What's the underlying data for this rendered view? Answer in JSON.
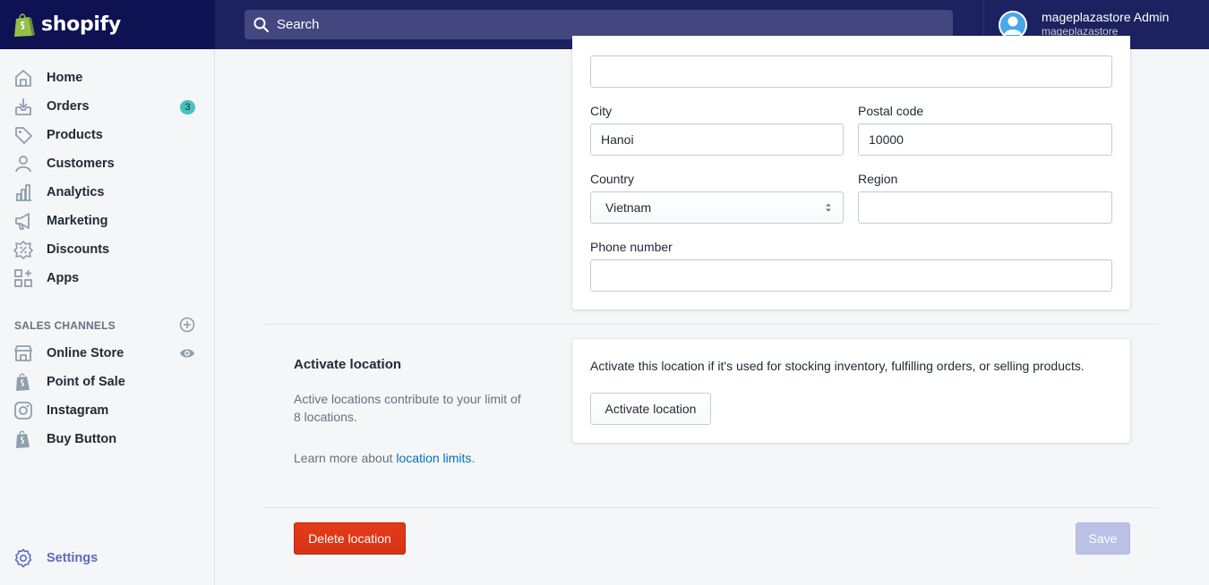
{
  "app": {
    "brand": "shopify"
  },
  "search": {
    "placeholder": "Search"
  },
  "user": {
    "name": "mageplazastore Admin",
    "store": "mageplazastore"
  },
  "sidebar": {
    "items": [
      {
        "label": "Home",
        "icon": "home-icon"
      },
      {
        "label": "Orders",
        "icon": "orders-icon",
        "badge": "3"
      },
      {
        "label": "Products",
        "icon": "tag-icon"
      },
      {
        "label": "Customers",
        "icon": "person-icon"
      },
      {
        "label": "Analytics",
        "icon": "bar-chart-icon"
      },
      {
        "label": "Marketing",
        "icon": "megaphone-icon"
      },
      {
        "label": "Discounts",
        "icon": "discount-icon"
      },
      {
        "label": "Apps",
        "icon": "apps-icon"
      }
    ],
    "sales_channels_title": "SALES CHANNELS",
    "channels": [
      {
        "label": "Online Store",
        "icon": "store-icon"
      },
      {
        "label": "Point of Sale",
        "icon": "shopify-bag-icon"
      },
      {
        "label": "Instagram",
        "icon": "instagram-icon"
      },
      {
        "label": "Buy Button",
        "icon": "shopify-bag-icon"
      }
    ],
    "settings": {
      "label": "Settings",
      "icon": "gear-icon"
    }
  },
  "address_form": {
    "city_label": "City",
    "city_value": "Hanoi",
    "postal_label": "Postal code",
    "postal_value": "10000",
    "country_label": "Country",
    "country_value": "Vietnam",
    "region_label": "Region",
    "region_value": "",
    "phone_label": "Phone number",
    "phone_value": ""
  },
  "activate_section": {
    "heading": "Activate location",
    "description": "Active locations contribute to your limit of 8 locations.",
    "learn_prefix": "Learn more about ",
    "learn_link": "location limits",
    "learn_suffix": ".",
    "card_text": "Activate this location if it's used for stocking inventory, fulfilling orders, or selling products.",
    "button": "Activate location"
  },
  "footer": {
    "delete_button": "Delete location",
    "save_button": "Save"
  },
  "colors": {
    "topbar": "#1c2260",
    "brand_bg": "#0e1152",
    "delete": "#de3618",
    "save_disabled": "#bac0e6",
    "link": "#006fbb",
    "badge": "#47c1bf"
  }
}
